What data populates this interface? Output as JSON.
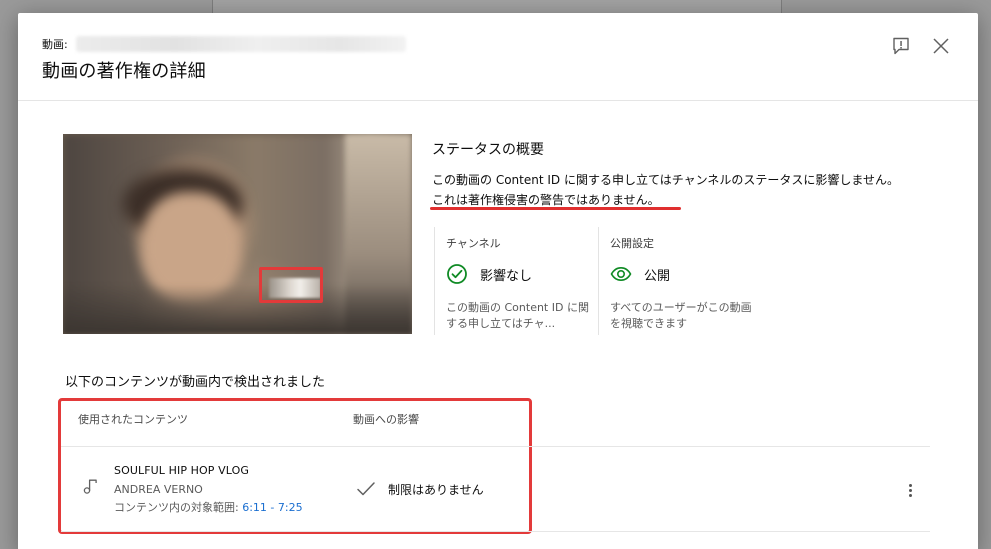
{
  "dialog": {
    "video_label": "動画:",
    "title": "動画の著作権の詳細",
    "feedback_icon": "feedback-icon",
    "close_icon": "close-icon"
  },
  "status": {
    "title": "ステータスの概要",
    "line1": "この動画の Content ID に関する申し立てはチャンネルのステータスに影響しません。",
    "line2": "これは著作権侵害の警告ではありません。",
    "channel": {
      "label": "チャンネル",
      "value": "影響なし",
      "icon": "check-circle-icon",
      "description": "この動画の Content ID に関する申し立てはチャ..."
    },
    "visibility": {
      "label": "公開設定",
      "value": "公開",
      "icon": "eye-icon",
      "description": "すべてのユーザーがこの動画を視聴できます"
    }
  },
  "detected": {
    "title": "以下のコンテンツが動画内で検出されました",
    "columns": [
      "使用されたコンテンツ",
      "動画への影響"
    ],
    "rows": [
      {
        "icon": "music-note-icon",
        "song": "SOULFUL HIP HOP VLOG",
        "artist": "ANDREA VERNO",
        "range_label": "コンテンツ内の対象範囲: ",
        "range_value": "6:11 - 7:25",
        "impact_icon": "check-icon",
        "impact": "制限はありません"
      }
    ]
  },
  "colors": {
    "accent_green": "#0f8a24",
    "link_blue": "#1a6ed0",
    "highlight_red": "#e33a3a"
  }
}
